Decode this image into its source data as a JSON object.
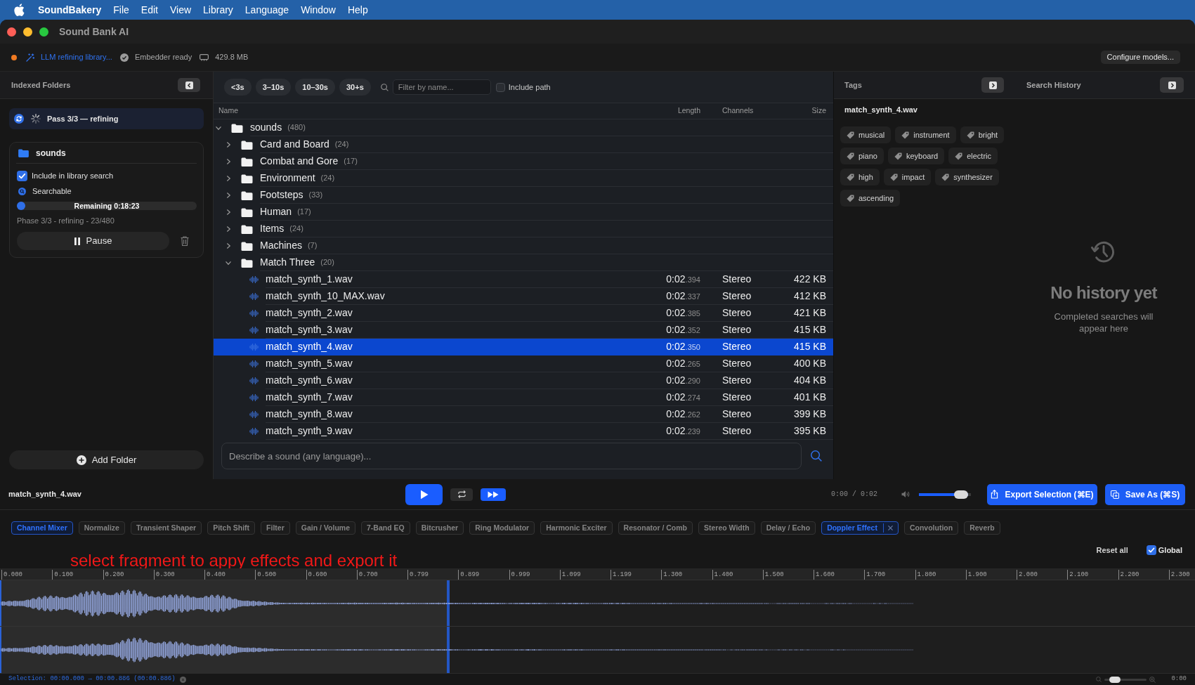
{
  "menu_bar": {
    "app_name": "SoundBakery",
    "items": [
      "File",
      "Edit",
      "View",
      "Library",
      "Language",
      "Window",
      "Help"
    ]
  },
  "window": {
    "title": "Sound Bank AI"
  },
  "status_strip": {
    "items": [
      {
        "kind": "activity",
        "text": "LLM refining library..."
      },
      {
        "kind": "ready",
        "text": "Embedder ready"
      },
      {
        "kind": "memory",
        "text": "429.8 MB"
      }
    ],
    "configure_button": "Configure models..."
  },
  "sidebar": {
    "title": "Indexed Folders",
    "pass_status": "Pass 3/3 — refining",
    "folder": {
      "name": "sounds",
      "include": {
        "label": "Include in library search",
        "checked": true
      },
      "searchable": "Searchable",
      "progress": {
        "level": 0.048,
        "reading": "Remaining 0:18:23"
      },
      "phase": "Phase 3/3 - refining - 23/480",
      "pause_button": "Pause"
    },
    "add_folder_button": "Add Folder"
  },
  "browser": {
    "duration_filters": [
      {
        "label": "<3s",
        "selected": false
      },
      {
        "label": "3–10s",
        "selected": false
      },
      {
        "label": "10–30s",
        "selected": false
      },
      {
        "label": "30+s",
        "selected": false
      }
    ],
    "filter_field": {
      "placeholder": "Filter by name..."
    },
    "include_path": {
      "label": "Include path",
      "checked": false
    },
    "columns": [
      "Name",
      "Length",
      "Channels",
      "Size"
    ],
    "tree": [
      {
        "kind": "folder",
        "name": "sounds",
        "count": "(480)",
        "expanded": true,
        "selected": false,
        "children": [
          {
            "kind": "folder",
            "name": "Card and Board",
            "count": "(24)",
            "expanded": false,
            "selected": false
          },
          {
            "kind": "folder",
            "name": "Combat and Gore",
            "count": "(17)",
            "expanded": false,
            "selected": false
          },
          {
            "kind": "folder",
            "name": "Environment",
            "count": "(24)",
            "expanded": false,
            "selected": false
          },
          {
            "kind": "folder",
            "name": "Footsteps",
            "count": "(33)",
            "expanded": false,
            "selected": false
          },
          {
            "kind": "folder",
            "name": "Human",
            "count": "(17)",
            "expanded": false,
            "selected": false
          },
          {
            "kind": "folder",
            "name": "Items",
            "count": "(24)",
            "expanded": false,
            "selected": false
          },
          {
            "kind": "folder",
            "name": "Machines",
            "count": "(7)",
            "expanded": false,
            "selected": false
          },
          {
            "kind": "folder",
            "name": "Match Three",
            "count": "(20)",
            "expanded": true,
            "selected": false,
            "children": [
              {
                "kind": "file",
                "name": "match_synth_1.wav",
                "length": "0:02",
                "length_fraction": ".394",
                "channels": "Stereo",
                "size": "422 KB",
                "selected": false
              },
              {
                "kind": "file",
                "name": "match_synth_10_MAX.wav",
                "length": "0:02",
                "length_fraction": ".337",
                "channels": "Stereo",
                "size": "412 KB",
                "selected": false
              },
              {
                "kind": "file",
                "name": "match_synth_2.wav",
                "length": "0:02",
                "length_fraction": ".385",
                "channels": "Stereo",
                "size": "421 KB",
                "selected": false
              },
              {
                "kind": "file",
                "name": "match_synth_3.wav",
                "length": "0:02",
                "length_fraction": ".352",
                "channels": "Stereo",
                "size": "415 KB",
                "selected": false
              },
              {
                "kind": "file",
                "name": "match_synth_4.wav",
                "length": "0:02",
                "length_fraction": ".350",
                "channels": "Stereo",
                "size": "415 KB",
                "selected": true
              },
              {
                "kind": "file",
                "name": "match_synth_5.wav",
                "length": "0:02",
                "length_fraction": ".265",
                "channels": "Stereo",
                "size": "400 KB",
                "selected": false
              },
              {
                "kind": "file",
                "name": "match_synth_6.wav",
                "length": "0:02",
                "length_fraction": ".290",
                "channels": "Stereo",
                "size": "404 KB",
                "selected": false
              },
              {
                "kind": "file",
                "name": "match_synth_7.wav",
                "length": "0:02",
                "length_fraction": ".274",
                "channels": "Stereo",
                "size": "401 KB",
                "selected": false
              },
              {
                "kind": "file",
                "name": "match_synth_8.wav",
                "length": "0:02",
                "length_fraction": ".262",
                "channels": "Stereo",
                "size": "399 KB",
                "selected": false
              },
              {
                "kind": "file",
                "name": "match_synth_9.wav",
                "length": "0:02",
                "length_fraction": ".239",
                "channels": "Stereo",
                "size": "395 KB",
                "selected": false
              }
            ]
          }
        ]
      }
    ],
    "search_field": {
      "placeholder": "Describe a sound (any language)..."
    }
  },
  "tags_panel": {
    "title": "Tags",
    "file_name": "match_synth_4.wav",
    "tags": [
      "musical",
      "instrument",
      "bright",
      "piano",
      "keyboard",
      "electric",
      "high",
      "impact",
      "synthesizer",
      "ascending"
    ]
  },
  "history_panel": {
    "title": "Search History",
    "empty_title": "No history yet",
    "empty_text": "Completed searches will appear here"
  },
  "player": {
    "file_name": "match_synth_4.wav",
    "transport": [
      {
        "kind": "play",
        "on": true
      },
      {
        "kind": "loop",
        "on": false
      },
      {
        "kind": "skip",
        "on": true
      }
    ],
    "time": "0:00 / 0:02",
    "volume": {
      "level": 0.95
    },
    "export_button": "Export Selection (⌘E)",
    "save_button": "Save As (⌘S)"
  },
  "effects": {
    "items": [
      {
        "label": "Channel Mixer",
        "active": true,
        "removable": false
      },
      {
        "label": "Normalize",
        "active": false,
        "removable": false
      },
      {
        "label": "Transient Shaper",
        "active": false,
        "removable": false
      },
      {
        "label": "Pitch Shift",
        "active": false,
        "removable": false
      },
      {
        "label": "Filter",
        "active": false,
        "removable": false
      },
      {
        "label": "Gain / Volume",
        "active": false,
        "removable": false
      },
      {
        "label": "7-Band EQ",
        "active": false,
        "removable": false
      },
      {
        "label": "Bitcrusher",
        "active": false,
        "removable": false
      },
      {
        "label": "Ring Modulator",
        "active": false,
        "removable": false
      },
      {
        "label": "Harmonic Exciter",
        "active": false,
        "removable": false
      },
      {
        "label": "Resonator / Comb",
        "active": false,
        "removable": false
      },
      {
        "label": "Stereo Width",
        "active": false,
        "removable": false
      },
      {
        "label": "Delay / Echo",
        "active": false,
        "removable": false
      },
      {
        "label": "Doppler Effect",
        "active": true,
        "removable": true
      },
      {
        "label": "Convolution",
        "active": false,
        "removable": false
      },
      {
        "label": "Reverb",
        "active": false,
        "removable": false
      }
    ],
    "reset_button": "Reset all",
    "global": {
      "label": "Global",
      "checked": true
    }
  },
  "annotation": "select fragment to appy effects and export it",
  "waveform": {
    "ruler": [
      "0.000",
      "0.100",
      "0.200",
      "0.300",
      "0.400",
      "0.500",
      "0.600",
      "0.700",
      "0.799",
      "0.899",
      "0.999",
      "1.099",
      "1.199",
      "1.300",
      "1.400",
      "1.500",
      "1.600",
      "1.700",
      "1.800",
      "1.900",
      "2.000",
      "2.100",
      "2.200",
      "2.300"
    ],
    "selection": {
      "level": 0.376
    }
  },
  "status_bar": {
    "selection": "Selection: 00:00.000 → 00:00.886 (00:00.886)",
    "zoom": {
      "level": 0.15
    },
    "time": "0:00"
  }
}
